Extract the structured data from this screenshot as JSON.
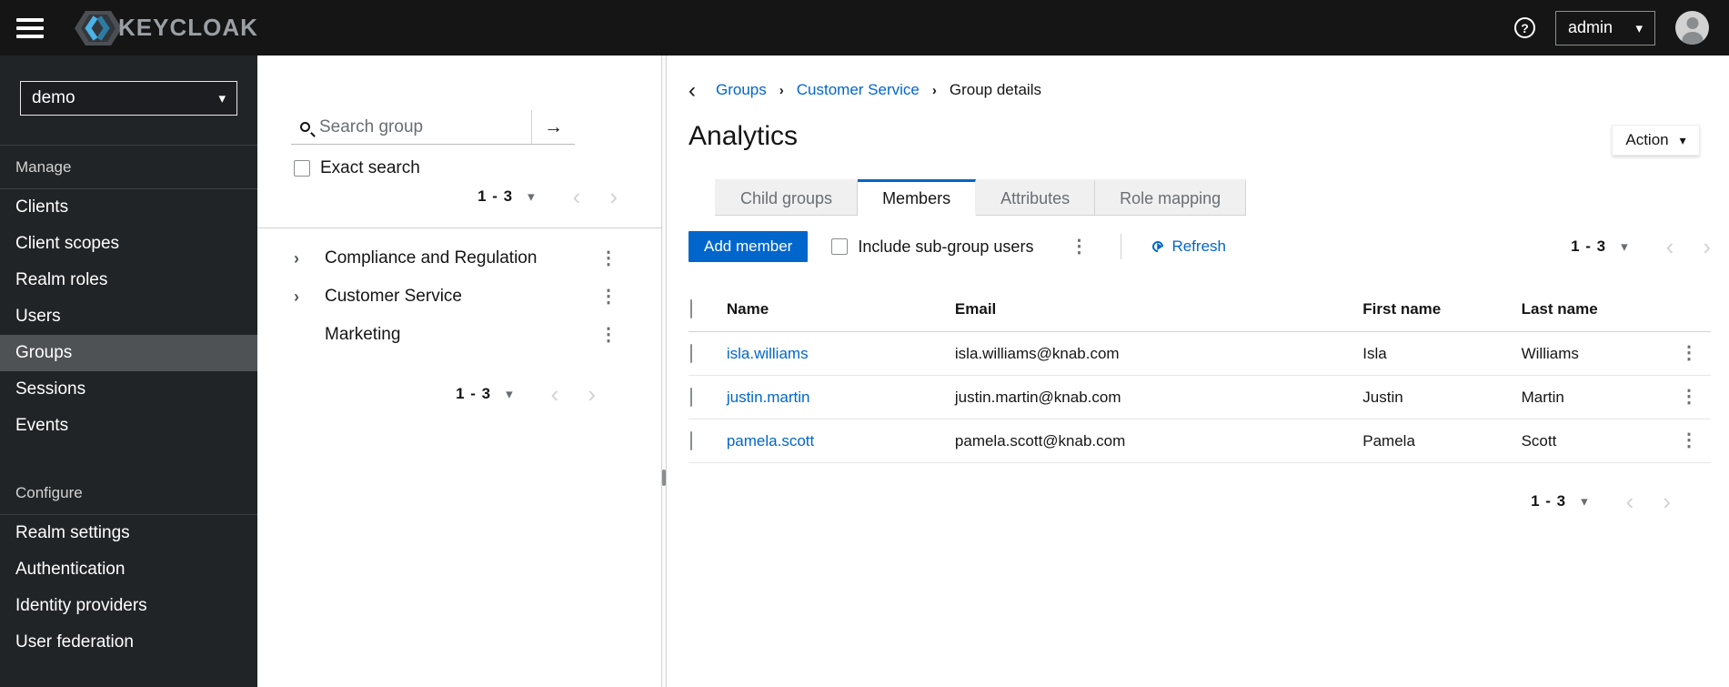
{
  "masthead": {
    "brand": "KEYCLOAK",
    "username": "admin"
  },
  "realm_selector": {
    "value": "demo"
  },
  "sidebar": {
    "active_item": "Groups",
    "sections": [
      {
        "label": "Manage",
        "items": [
          "Clients",
          "Client scopes",
          "Realm roles",
          "Users",
          "Groups",
          "Sessions",
          "Events"
        ]
      },
      {
        "label": "Configure",
        "items": [
          "Realm settings",
          "Authentication",
          "Identity providers",
          "User federation"
        ]
      }
    ]
  },
  "tree_panel": {
    "search_placeholder": "Search group",
    "exact_search_label": "Exact search",
    "pagination_top": "1 - 3",
    "pagination_bottom": "1 - 3",
    "groups": [
      {
        "name": "Compliance and Regulation",
        "expandable": true
      },
      {
        "name": "Customer Service",
        "expandable": true
      },
      {
        "name": "Marketing",
        "expandable": false
      }
    ]
  },
  "main": {
    "breadcrumb": {
      "items": [
        "Groups",
        "Customer Service"
      ],
      "current": "Group details"
    },
    "title": "Analytics",
    "action_button": "Action",
    "tabs": [
      {
        "label": "Child groups",
        "active": false
      },
      {
        "label": "Members",
        "active": true
      },
      {
        "label": "Attributes",
        "active": false
      },
      {
        "label": "Role mapping",
        "active": false
      }
    ],
    "toolbar": {
      "add_member": "Add member",
      "include_subgroups": "Include sub-group users",
      "refresh": "Refresh",
      "pagination": "1 - 3"
    },
    "table": {
      "headers": [
        "Name",
        "Email",
        "First name",
        "Last name"
      ],
      "rows": [
        {
          "name": "isla.williams",
          "email": "isla.williams@knab.com",
          "first_name": "Isla",
          "last_name": "Williams"
        },
        {
          "name": "justin.martin",
          "email": "justin.martin@knab.com",
          "first_name": "Justin",
          "last_name": "Martin"
        },
        {
          "name": "pamela.scott",
          "email": "pamela.scott@knab.com",
          "first_name": "Pamela",
          "last_name": "Scott"
        }
      ]
    },
    "pagination_bottom": "1 - 3"
  },
  "icons": {
    "caret_down": "▾",
    "chevron_left": "‹",
    "chevron_right": "›",
    "kebab": "⋮",
    "search_submit": "→",
    "breadcrumb_back": "‹",
    "breadcrumb_separator": "›",
    "tree_expand": "›",
    "help": "?"
  },
  "colors": {
    "accent": "#0066cc",
    "masthead_bg": "#151515",
    "sidebar_bg": "#212427",
    "sidebar_active_bg": "#4f5255",
    "link": "#0066cc",
    "tab_inactive_bg": "#f0f0f0"
  }
}
